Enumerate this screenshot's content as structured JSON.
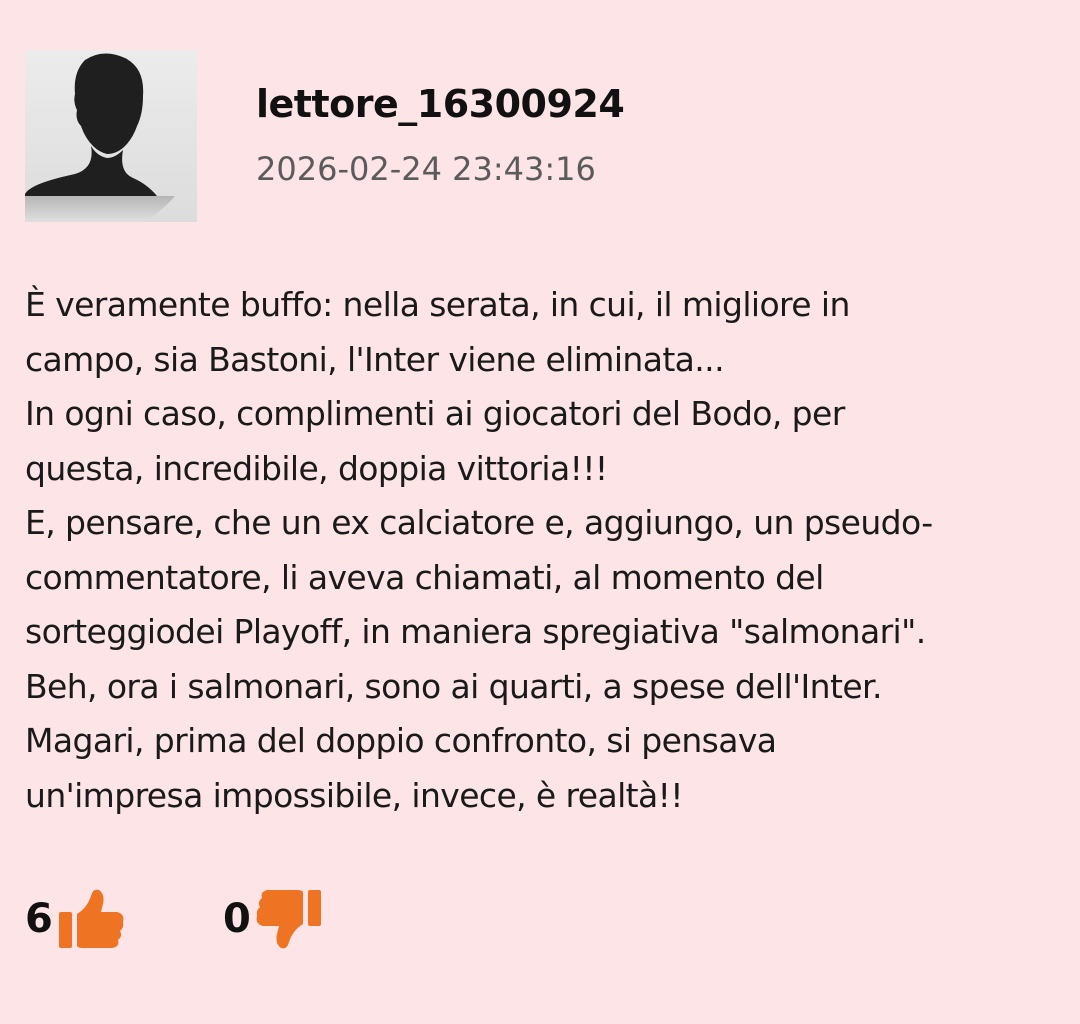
{
  "comment": {
    "username": "lettore_16300924",
    "timestamp": "2026-02-24 23:43:16",
    "avatar_icon": "user-silhouette-icon",
    "body_lines": [
      "È veramente buffo: nella serata, in cui, il migliore in",
      "campo, sia Bastoni, l'Inter viene eliminata...",
      "In ogni caso, complimenti ai giocatori del Bodo, per",
      "questa, incredibile, doppia vittoria!!!",
      "E, pensare, che un ex calciatore e, aggiungo, un pseudo-",
      "commentatore, li aveva chiamati, al momento del",
      "sorteggiodei Playoff, in maniera spregiativa \"salmonari\".",
      "Beh, ora i salmonari, sono ai quarti, a spese dell'Inter.",
      "Magari, prima del doppio confronto, si pensava",
      "un'impresa impossibile, invece, è realtà!!"
    ]
  },
  "votes": {
    "likes": "6",
    "dislikes": "0",
    "like_icon": "thumbs-up-icon",
    "dislike_icon": "thumbs-down-icon"
  },
  "colors": {
    "background": "#fce4e7",
    "accent": "#ee7322",
    "avatar_bg": "#e6e6e6"
  }
}
